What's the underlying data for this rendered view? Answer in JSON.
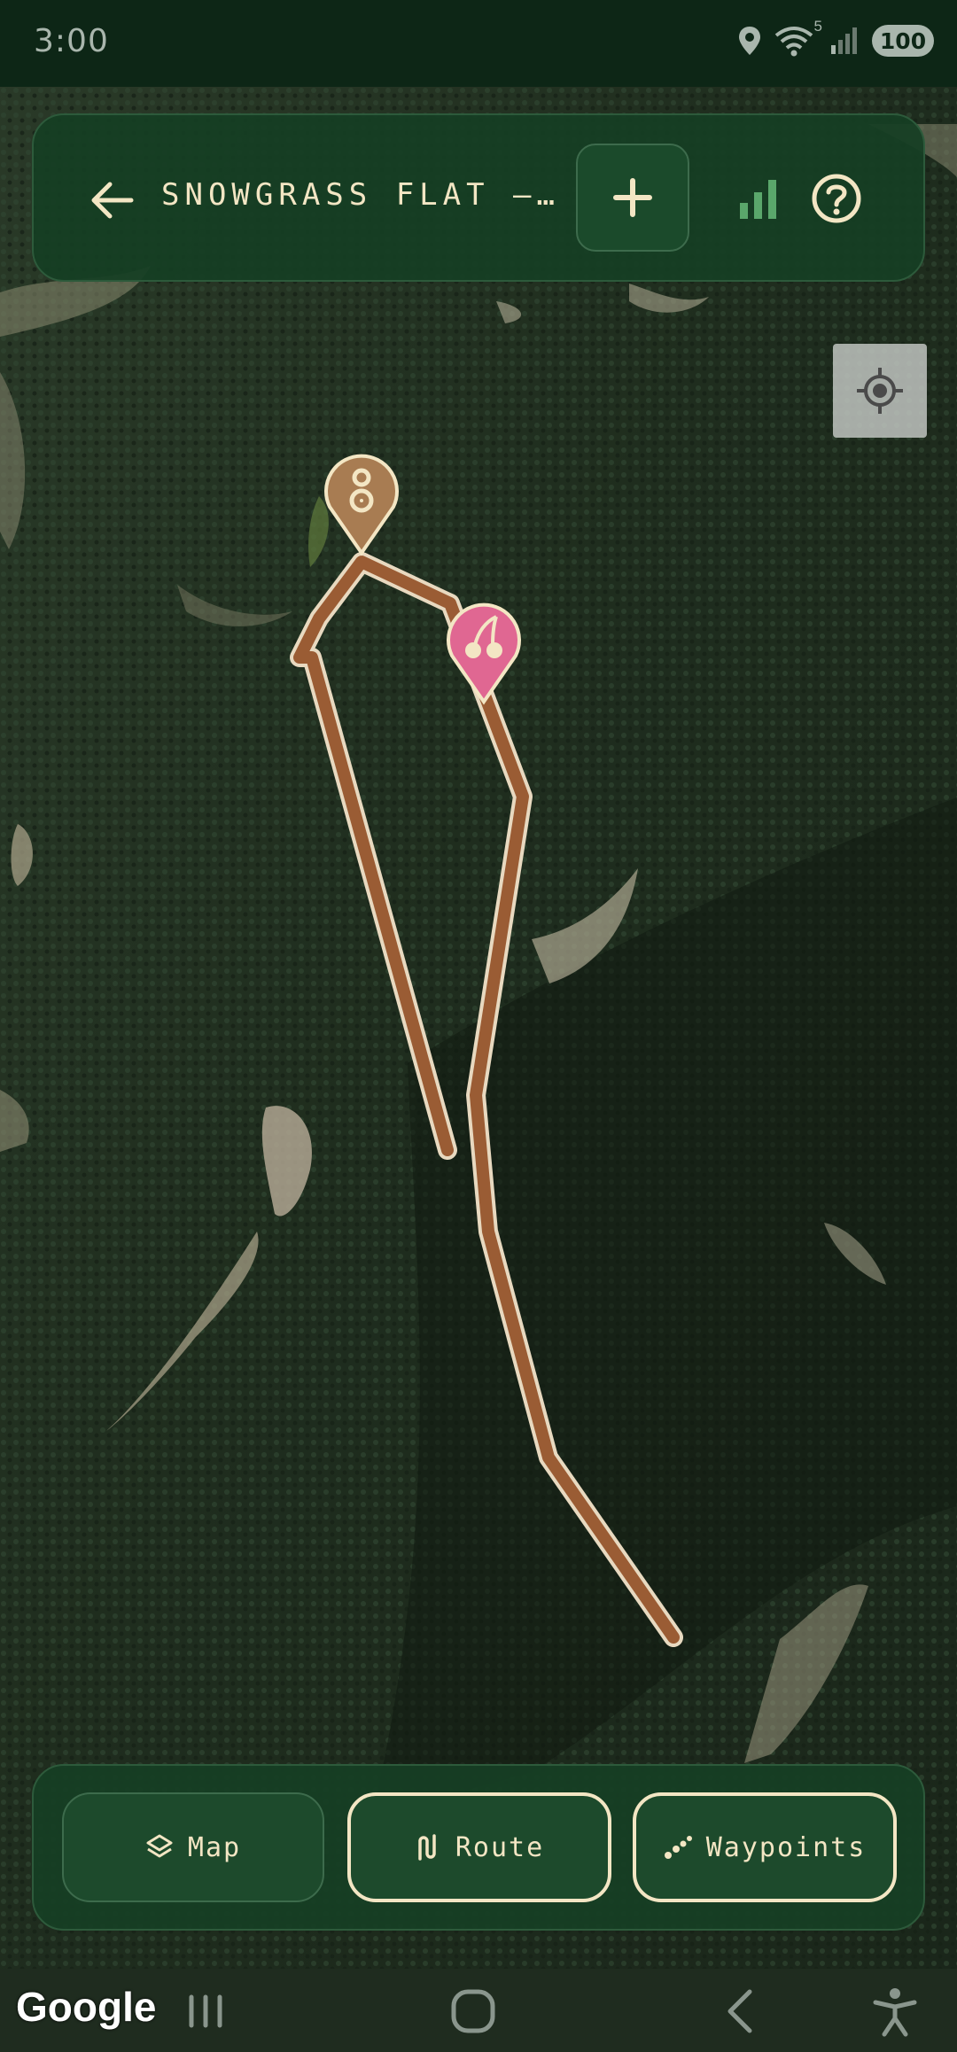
{
  "status_bar": {
    "time": "3:00",
    "wifi_badge": "5",
    "battery": "100"
  },
  "header": {
    "title": "SNOWGRASS FLAT –…",
    "back_icon": "arrow-left-icon",
    "add_icon": "plus-icon",
    "stats_icon": "bar-chart-icon",
    "help_icon": "question-circle-icon"
  },
  "map": {
    "locate_icon": "crosshair-icon",
    "markers": [
      {
        "name": "camp-marker",
        "icon": "campsite-icon",
        "color": "#a87c52"
      },
      {
        "name": "berries-marker",
        "icon": "cherry-icon",
        "color": "#e06792"
      }
    ],
    "route_color": "#9a5c34",
    "route_outline": "#e8d9c0"
  },
  "bottom_bar": {
    "map_label": "Map",
    "route_label": "Route",
    "waypoints_label": "Waypoints"
  },
  "nav_bar": {
    "attribution": "Google"
  },
  "colors": {
    "panel": "#163e24",
    "accent_text": "#f3e6c4",
    "stats_green": "#5aa76b",
    "status_bar_bg": "#0d2616"
  }
}
